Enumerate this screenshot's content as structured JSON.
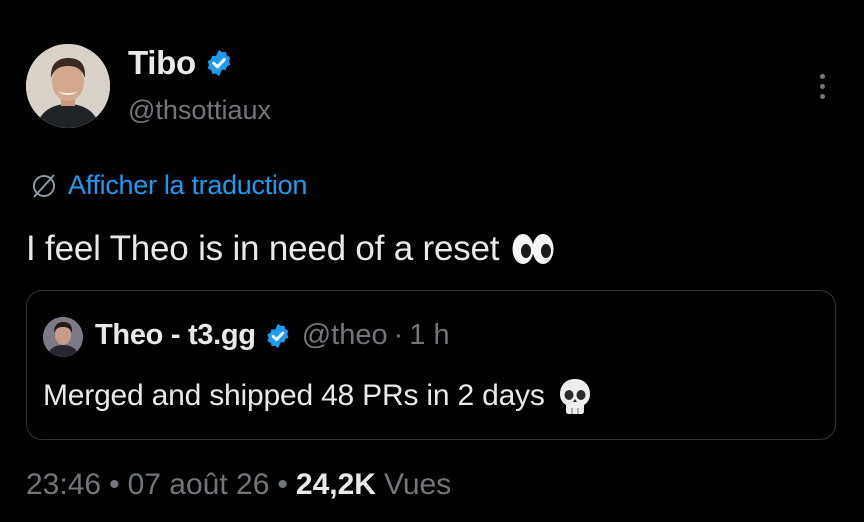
{
  "author": {
    "name": "Tibo",
    "handle": "@thsottiaux",
    "verified_icon": "verified-badge-icon",
    "verified_color": "#1d9bf0"
  },
  "translate_link": {
    "label": "Afficher la traduction",
    "icon": "translate-globe-icon",
    "color": "#1d9bf0"
  },
  "tweet": {
    "text": "I feel Theo is in need of a reset",
    "emoji": "eyes-emoji-icon"
  },
  "quoted_tweet": {
    "name": "Theo - t3.gg",
    "handle": "@theo",
    "separator": "·",
    "time": "1 h",
    "text": "Merged and shipped 48 PRs in 2 days",
    "emoji": "skull-emoji-icon"
  },
  "meta": {
    "time": "23:46",
    "separator": "•",
    "date": "07 août 26",
    "views_count": "24,2K",
    "views_label": "Vues"
  },
  "colors": {
    "background": "#000000",
    "primary_text": "#e7e9ea",
    "secondary_text": "#71767b",
    "border": "#2f3336"
  }
}
